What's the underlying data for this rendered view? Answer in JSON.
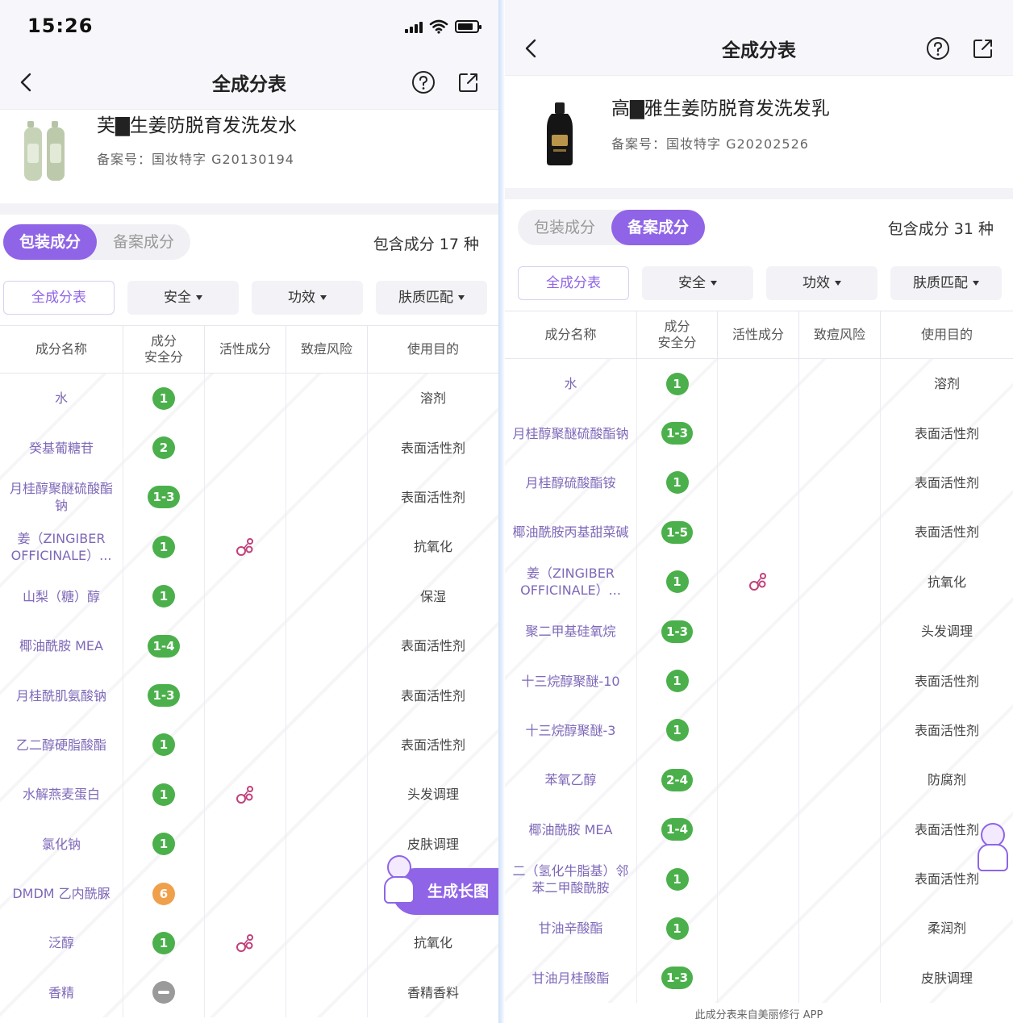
{
  "left": {
    "status": {
      "time": "15:26"
    },
    "nav": {
      "title": "全成分表"
    },
    "product": {
      "name": "芙▇生姜防脱育发洗发水",
      "reg": "备案号：国妆特字 G20130194"
    },
    "tabs": [
      {
        "label": "包装成分",
        "active": true
      },
      {
        "label": "备案成分",
        "active": false
      }
    ],
    "count": "包含成分 17 种",
    "filters": [
      {
        "label": "全成分表",
        "active": true,
        "caret": false
      },
      {
        "label": "安全",
        "active": false,
        "caret": true
      },
      {
        "label": "功效",
        "active": false,
        "caret": true
      },
      {
        "label": "肤质匹配",
        "active": false,
        "caret": true
      }
    ],
    "headers": [
      "成分名称",
      "成分\n安全分",
      "活性成分",
      "致痘风险",
      "使用目的"
    ],
    "rows": [
      {
        "name": "水",
        "safety": "1",
        "color": "green",
        "active": false,
        "purpose": "溶剂"
      },
      {
        "name": "癸基葡糖苷",
        "safety": "2",
        "color": "green",
        "active": false,
        "purpose": "表面活性剂"
      },
      {
        "name": "月桂醇聚醚硫酸酯钠",
        "safety": "1-3",
        "color": "green",
        "active": false,
        "purpose": "表面活性剂"
      },
      {
        "name": "姜（ZINGIBER OFFICINALE）...",
        "safety": "1",
        "color": "green",
        "active": true,
        "purpose": "抗氧化"
      },
      {
        "name": "山梨（糖）醇",
        "safety": "1",
        "color": "green",
        "active": false,
        "purpose": "保湿"
      },
      {
        "name": "椰油酰胺 MEA",
        "safety": "1-4",
        "color": "green",
        "active": false,
        "purpose": "表面活性剂"
      },
      {
        "name": "月桂酰肌氨酸钠",
        "safety": "1-3",
        "color": "green",
        "active": false,
        "purpose": "表面活性剂"
      },
      {
        "name": "乙二醇硬脂酸酯",
        "safety": "1",
        "color": "green",
        "active": false,
        "purpose": "表面活性剂"
      },
      {
        "name": "水解燕麦蛋白",
        "safety": "1",
        "color": "green",
        "active": true,
        "purpose": "头发调理"
      },
      {
        "name": "氯化钠",
        "safety": "1",
        "color": "green",
        "active": false,
        "purpose": "皮肤调理"
      },
      {
        "name": "DMDM 乙内酰脲",
        "safety": "6",
        "color": "orange",
        "active": false,
        "purpose": ""
      },
      {
        "name": "泛醇",
        "safety": "1",
        "color": "green",
        "active": true,
        "purpose": "抗氧化"
      },
      {
        "name": "香精",
        "safety": "",
        "color": "gray",
        "active": false,
        "purpose": "香精香料"
      }
    ],
    "float_button": "生成长图"
  },
  "right": {
    "nav": {
      "title": "全成分表"
    },
    "product": {
      "name": "高▇雅生姜防脱育发洗发乳",
      "reg": "备案号：国妆特字 G20202526"
    },
    "tabs": [
      {
        "label": "包装成分",
        "active": false
      },
      {
        "label": "备案成分",
        "active": true
      }
    ],
    "count": "包含成分 31 种",
    "filters": [
      {
        "label": "全成分表",
        "active": true,
        "caret": false
      },
      {
        "label": "安全",
        "active": false,
        "caret": true
      },
      {
        "label": "功效",
        "active": false,
        "caret": true
      },
      {
        "label": "肤质匹配",
        "active": false,
        "caret": true
      }
    ],
    "headers": [
      "成分名称",
      "成分\n安全分",
      "活性成分",
      "致痘风险",
      "使用目的"
    ],
    "rows": [
      {
        "name": "水",
        "safety": "1",
        "color": "green",
        "active": false,
        "purpose": "溶剂"
      },
      {
        "name": "月桂醇聚醚硫酸酯钠",
        "safety": "1-3",
        "color": "green",
        "active": false,
        "purpose": "表面活性剂"
      },
      {
        "name": "月桂醇硫酸酯铵",
        "safety": "1",
        "color": "green",
        "active": false,
        "purpose": "表面活性剂"
      },
      {
        "name": "椰油酰胺丙基甜菜碱",
        "safety": "1-5",
        "color": "green",
        "active": false,
        "purpose": "表面活性剂"
      },
      {
        "name": "姜（ZINGIBER OFFICINALE）...",
        "safety": "1",
        "color": "green",
        "active": true,
        "purpose": "抗氧化"
      },
      {
        "name": "聚二甲基硅氧烷",
        "safety": "1-3",
        "color": "green",
        "active": false,
        "purpose": "头发调理"
      },
      {
        "name": "十三烷醇聚醚-10",
        "safety": "1",
        "color": "green",
        "active": false,
        "purpose": "表面活性剂"
      },
      {
        "name": "十三烷醇聚醚-3",
        "safety": "1",
        "color": "green",
        "active": false,
        "purpose": "表面活性剂"
      },
      {
        "name": "苯氧乙醇",
        "safety": "2-4",
        "color": "green",
        "active": false,
        "purpose": "防腐剂"
      },
      {
        "name": "椰油酰胺 MEA",
        "safety": "1-4",
        "color": "green",
        "active": false,
        "purpose": "表面活性剂"
      },
      {
        "name": "二（氢化牛脂基）邻苯二甲酸酰胺",
        "safety": "1",
        "color": "green",
        "active": false,
        "purpose": "表面活性剂"
      },
      {
        "name": "甘油辛酸酯",
        "safety": "1",
        "color": "green",
        "active": false,
        "purpose": "柔润剂"
      },
      {
        "name": "甘油月桂酸酯",
        "safety": "1-3",
        "color": "green",
        "active": false,
        "purpose": "皮肤调理"
      }
    ],
    "footer": "此成分表来自美丽修行 APP"
  },
  "colors": {
    "accent": "#8f64e6",
    "safe_green": "#4bb04b",
    "safe_orange": "#f0a04b",
    "active_icon": "#c0407a"
  },
  "icons": [
    "back-arrow-icon",
    "help-icon",
    "share-icon",
    "active-ingredient-icon",
    "signal-icon",
    "wifi-icon",
    "battery-icon"
  ]
}
